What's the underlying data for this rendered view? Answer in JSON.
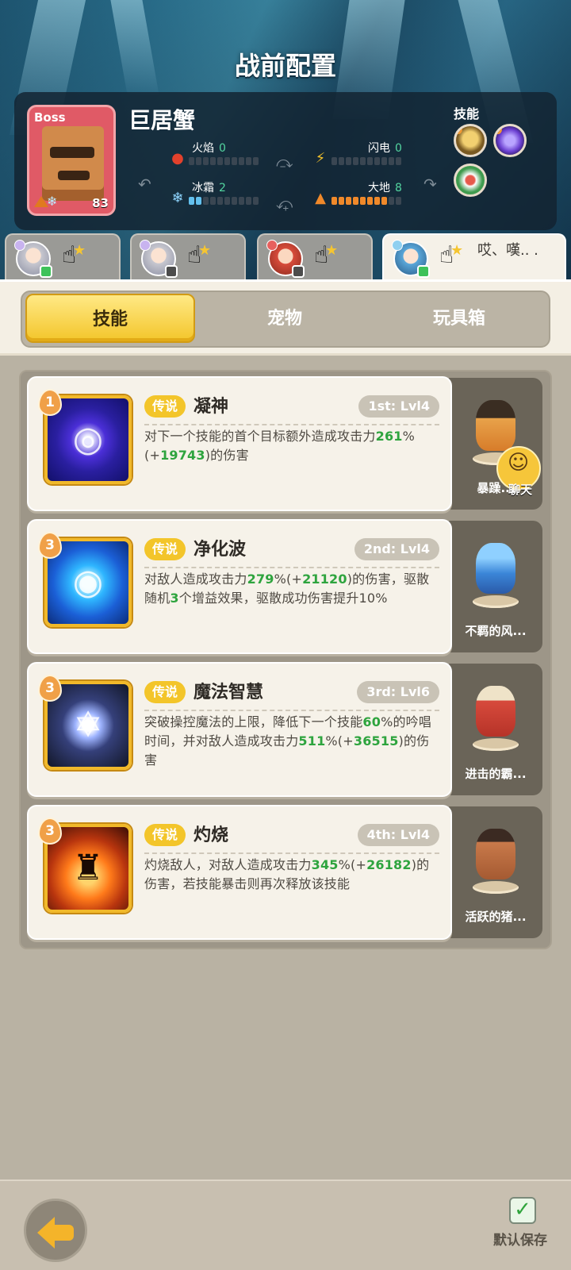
{
  "header": {
    "title": "战前配置"
  },
  "boss": {
    "tag": "Boss",
    "name": "巨居蟹",
    "level": "83",
    "elements": [
      {
        "name": "火焰",
        "value": "0"
      },
      {
        "name": "闪电",
        "value": "0"
      },
      {
        "name": "冰霜",
        "value": "2"
      },
      {
        "name": "大地",
        "value": "8"
      }
    ],
    "skills_label": "技能",
    "skill_icons": [
      "boss-skill-1-icon",
      "boss-skill-2-icon",
      "boss-skill-3-icon"
    ]
  },
  "hero_tabs": [
    {
      "note": ""
    },
    {
      "note": ""
    },
    {
      "note": ""
    },
    {
      "note": "哎、嘆.. ."
    }
  ],
  "main_tabs": [
    "技能",
    "宠物",
    "玩具箱"
  ],
  "skills": [
    {
      "level": "1",
      "rarity": "传说",
      "name": "凝神",
      "order": "1st: Lvl4",
      "desc_parts": [
        "对下一个技能的首个目标额外造成攻击力",
        "261",
        "%(+",
        "19743",
        ")的伤害"
      ],
      "pet": "暴躁..."
    },
    {
      "level": "3",
      "rarity": "传说",
      "name": "净化波",
      "order": "2nd: Lvl4",
      "desc_parts": [
        "对敌人造成攻击力",
        "279",
        "%(+",
        "21120",
        ")的伤害，驱散随机",
        "3",
        "个增益效果，驱散成功伤害提升10%"
      ],
      "pet": "不羁的风..."
    },
    {
      "level": "3",
      "rarity": "传说",
      "name": "魔法智慧",
      "order": "3rd: Lvl6",
      "desc_parts": [
        "突破操控魔法的上限，降低下一个技能",
        "60",
        "%的吟唱时间，并对敌人造成攻击力",
        "511",
        "%(+",
        "36515",
        ")的伤害"
      ],
      "pet": "进击的霸..."
    },
    {
      "level": "3",
      "rarity": "传说",
      "name": "灼烧",
      "order": "4th: Lvl4",
      "desc_parts": [
        "灼烧敌人，对敌人造成攻击力",
        "345",
        "%(+",
        "26182",
        ")的伤害，若技能暴击则再次释放该技能"
      ],
      "pet": "活跃的猪..."
    }
  ],
  "chat": {
    "label": "聊天"
  },
  "footer": {
    "save_label": "默认保存"
  },
  "colors": {
    "accent_yellow": "#f3c52a",
    "highlight_green": "#2ea43e",
    "panel_dark": "#6a6458"
  }
}
